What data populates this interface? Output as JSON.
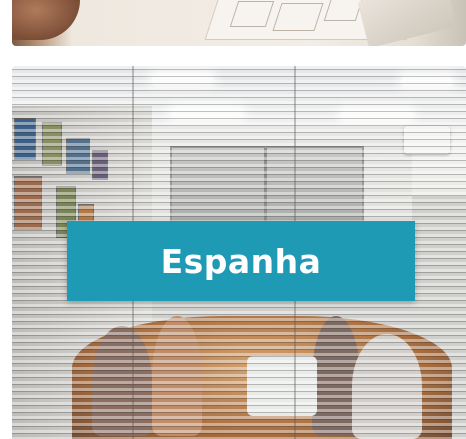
{
  "gallery": {
    "items": [
      {
        "label": ""
      },
      {
        "label": "Espanha"
      }
    ]
  },
  "colors": {
    "label_background": "#1e9ab5",
    "label_text": "#ffffff",
    "page_background": "#ffffff"
  }
}
